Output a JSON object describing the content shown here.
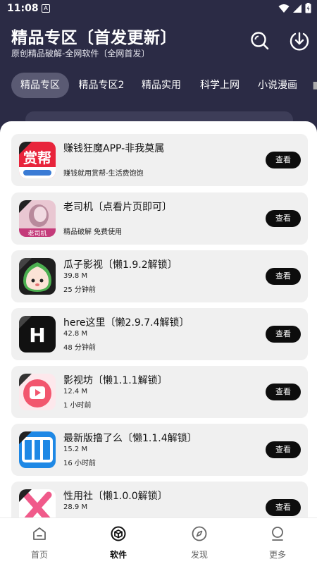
{
  "status_bar": {
    "time": "11:08",
    "app_glyph": "A"
  },
  "header": {
    "title": "精品专区〔首发更新〕",
    "subtitle": "原创精品破解-全网软件〔全网首发〕"
  },
  "tabs": [
    "精品专区",
    "精品专区2",
    "精品实用",
    "科学上网",
    "小说漫画"
  ],
  "active_tab": "精品专区",
  "apps": [
    {
      "title": "赚钱狂魔APP-非我莫属",
      "line1": "",
      "line2": "赚钱就用赏帮-生活费饱饱",
      "icon": "money-app-icon",
      "button": "查看"
    },
    {
      "title": "老司机〔点看片页即可〕",
      "line1": "",
      "line2": "精品破解 免费使用",
      "icon": "driver-app-icon",
      "button": "查看"
    },
    {
      "title": "瓜子影视〔懒1.9.2解锁〕",
      "line1": "39.8 M",
      "line2": "25 分钟前",
      "icon": "melon-seed-app-icon",
      "button": "查看"
    },
    {
      "title": "here这里〔懒2.9.7.4解锁〕",
      "line1": "42.8 M",
      "line2": "48 分钟前",
      "icon": "here-app-icon",
      "button": "查看"
    },
    {
      "title": "影视坊〔懒1.1.1解锁〕",
      "line1": "12.4 M",
      "line2": "1 小时前",
      "icon": "video-play-app-icon",
      "button": "查看"
    },
    {
      "title": "最新版撸了么〔懒1.1.4解锁〕",
      "line1": "15.2 M",
      "line2": "16 小时前",
      "icon": "blue-app-icon",
      "button": "查看"
    },
    {
      "title": "性用社〔懒1.0.0解锁〕",
      "line1": "28.9 M",
      "line2": "",
      "icon": "pink-x-app-icon",
      "button": "查看"
    }
  ],
  "bottom_nav": [
    {
      "label": "首页",
      "icon": "home-icon"
    },
    {
      "label": "软件",
      "icon": "package-icon"
    },
    {
      "label": "发现",
      "icon": "compass-icon"
    },
    {
      "label": "更多",
      "icon": "person-icon"
    }
  ],
  "active_nav": "软件",
  "colors": {
    "header_bg": "#2b2b45",
    "button_bg": "#0d0d0d",
    "card_bg": "#f0f0f0"
  }
}
